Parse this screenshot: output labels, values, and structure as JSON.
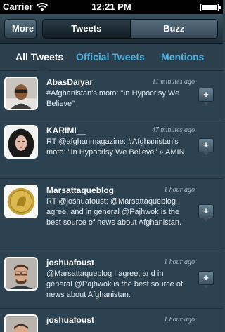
{
  "status_bar": {
    "carrier": "Carrier",
    "time": "12:21 PM"
  },
  "nav": {
    "back_label": "More",
    "segments": [
      "Tweets",
      "Buzz"
    ]
  },
  "filters": [
    "All Tweets",
    "Official Tweets",
    "Mentions"
  ],
  "tweets": [
    {
      "user": "AbasDaiyar",
      "time": "11 minutes ago",
      "text": "#Afghanistan's moto: \"In Hypocrisy We Believe\""
    },
    {
      "user": "KARIMI__",
      "time": "47 minutes ago",
      "text": "RT @afghanmagazine: #Afghanistan's moto: \"In Hypocrisy We Believe\" » AMIN"
    },
    {
      "user": "Marsattaqueblog",
      "time": "1 hour ago",
      "text": "RT @joshuafoust: @Marsattaqueblog I agree, and in general @Pajhwok is the best source of news about Afghanistan."
    },
    {
      "user": "joshuafoust",
      "time": "1 hour ago",
      "text": "@Marsattaqueblog I agree, and in general @Pajhwok is the best source of news about Afghanistan."
    },
    {
      "user": "joshuafoust",
      "time": "1 hour ago",
      "text": ""
    }
  ],
  "reply_label": "+",
  "colors": {
    "accent": "#4ab3e6",
    "background": "#2d4250",
    "nav_dark": "#1f2e37"
  }
}
